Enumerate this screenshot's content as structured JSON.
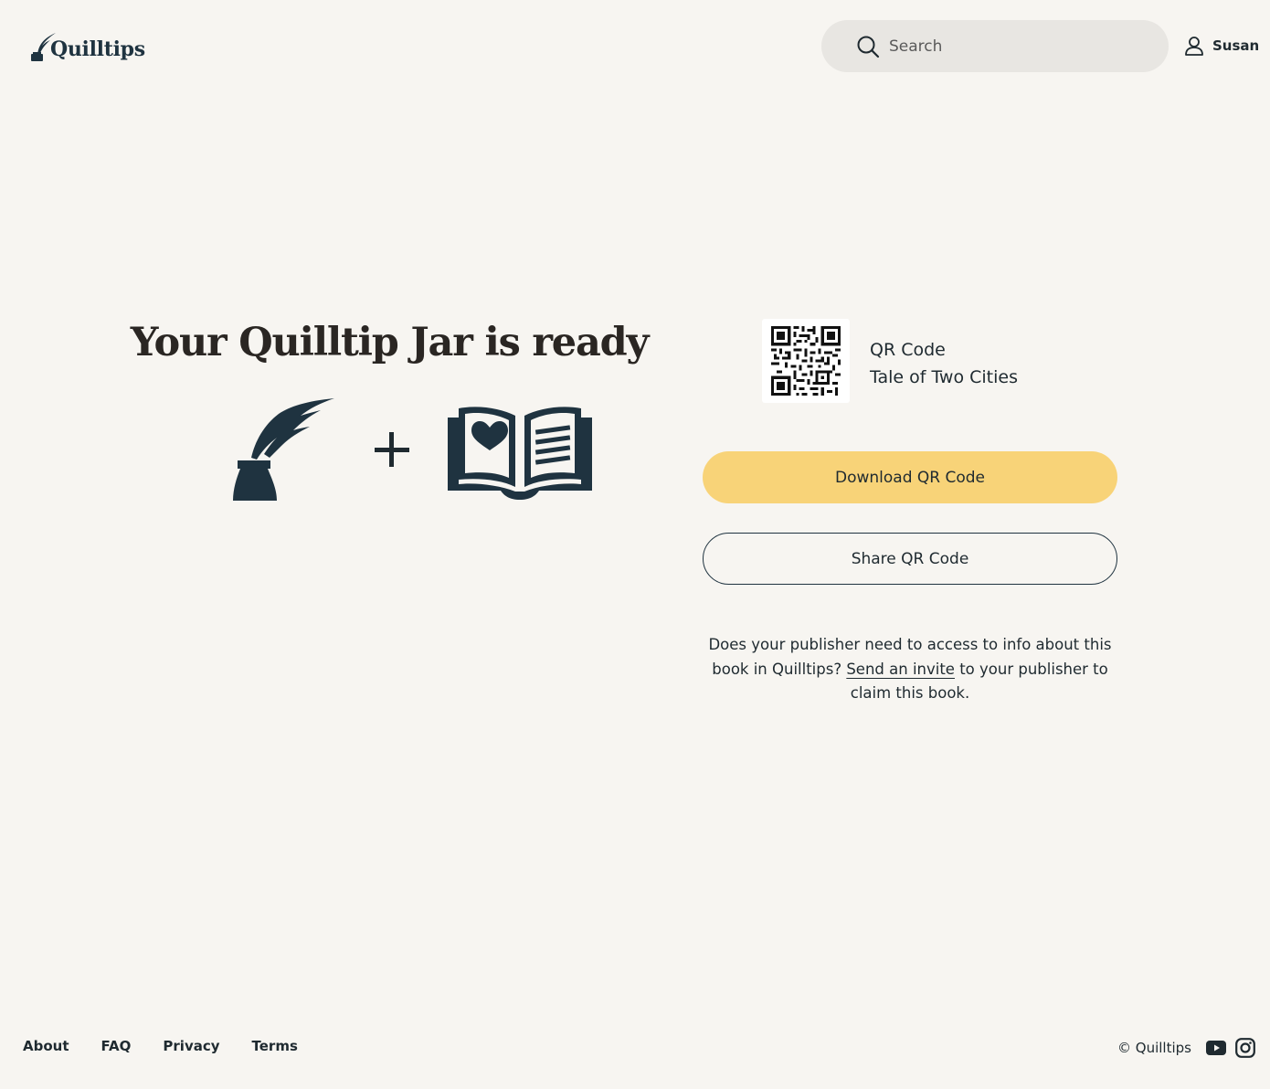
{
  "header": {
    "logo_text": "Quilltips",
    "search_placeholder": "Search",
    "user_name": "Susan"
  },
  "hero": {
    "title": "Your Quilltip Jar is ready",
    "plus_symbol": "+"
  },
  "qr": {
    "label": "QR Code",
    "book_title": "Tale of Two Cities",
    "download_label": "Download QR Code",
    "share_label": "Share QR Code"
  },
  "publisher_note": {
    "before": "Does your publisher need to access to info about this book in Quilltips? ",
    "link": "Send an invite",
    "after": " to your publisher to claim this book."
  },
  "footer": {
    "links": [
      "About",
      "FAQ",
      "Privacy",
      "Terms"
    ],
    "copyright": "© Quilltips"
  },
  "colors": {
    "background": "#f7f5f1",
    "accent": "#f8d378",
    "ink": "#1f3340"
  },
  "icons": [
    "quill-logo-icon",
    "search-icon",
    "user-icon",
    "quill-inkwell-icon",
    "open-book-heart-icon",
    "qr-code-image",
    "youtube-icon",
    "instagram-icon"
  ]
}
